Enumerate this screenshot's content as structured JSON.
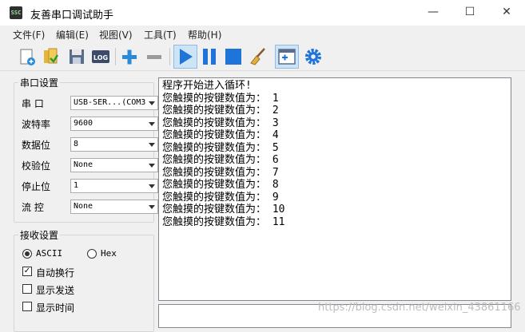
{
  "window": {
    "title": "友善串口调试助手",
    "icon_text": "SSC"
  },
  "menu": [
    "文件(F)",
    "编辑(E)",
    "视图(V)",
    "工具(T)",
    "帮助(H)"
  ],
  "toolbar": {
    "icons": [
      "new-icon",
      "open-icon",
      "save-icon",
      "log-icon",
      "add-icon",
      "remove-icon",
      "play-icon",
      "pause-icon",
      "stop-icon",
      "clear-broom-icon",
      "new-window-icon",
      "settings-gear-icon"
    ],
    "log_label": "LOG"
  },
  "serial_settings": {
    "title": "串口设置",
    "fields": [
      {
        "label": "串  口",
        "value": "USB-SER...(COM3"
      },
      {
        "label": "波特率",
        "value": "9600"
      },
      {
        "label": "数据位",
        "value": "8"
      },
      {
        "label": "校验位",
        "value": "None"
      },
      {
        "label": "停止位",
        "value": "1"
      },
      {
        "label": "流  控",
        "value": "None"
      }
    ]
  },
  "receive_settings": {
    "title": "接收设置",
    "ascii": "ASCII",
    "hex": "Hex",
    "auto_wrap": "自动换行",
    "show_send": "显示发送",
    "show_time": "显示时间"
  },
  "receive_output": [
    "程序开始进入循环!",
    "您触摸的按键数值为： 1",
    "您触摸的按键数值为： 2",
    "您触摸的按键数值为： 3",
    "您触摸的按键数值为： 4",
    "您触摸的按键数值为： 5",
    "您触摸的按键数值为： 6",
    "您触摸的按键数值为： 7",
    "您触摸的按键数值为： 8",
    "您触摸的按键数值为： 9",
    "您触摸的按键数值为： 10",
    "您触摸的按键数值为： 11"
  ],
  "watermark": "https://blog.csdn.net/weixin_43861166",
  "colors": {
    "accent_blue": "#1e74d8"
  }
}
